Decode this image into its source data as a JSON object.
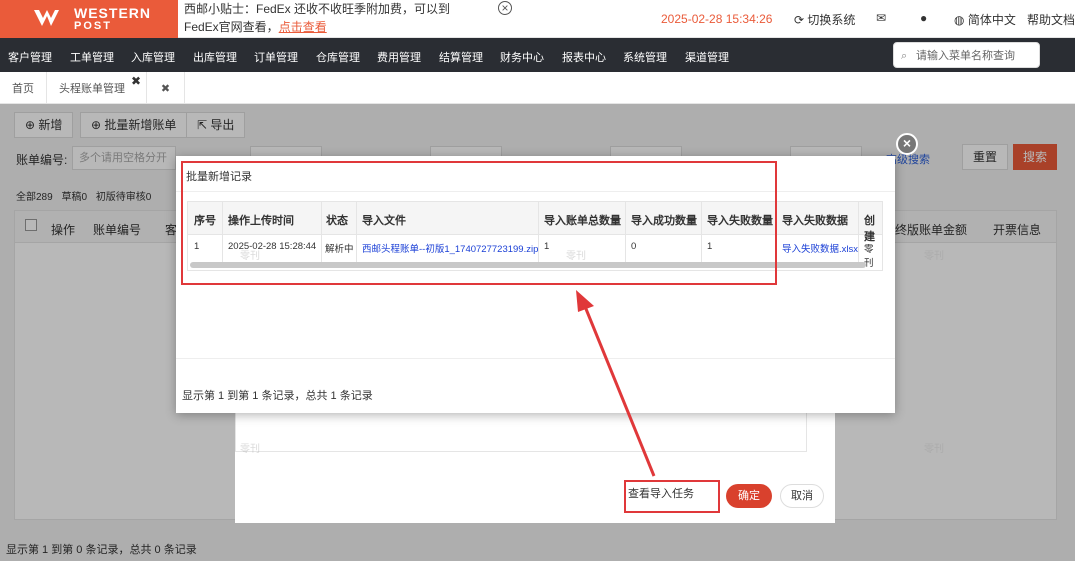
{
  "header": {
    "logo_line1": "WESTERN",
    "logo_line2": "POST",
    "notice_text": "西邮小贴士：FedEx 还收不收旺季附加费，可以到FedEx官网查看，",
    "notice_link": "点击查看",
    "datetime": "2025-02-28 15:34:26",
    "switch_system": "切换系统",
    "language": "简体中文",
    "help": "帮助文档"
  },
  "nav": {
    "items": [
      "客户管理",
      "工单管理",
      "入库管理",
      "出库管理",
      "订单管理",
      "仓库管理",
      "费用管理",
      "结算管理",
      "财务中心",
      "报表中心",
      "系统管理",
      "渠道管理"
    ],
    "search_placeholder": "请输入菜单名称查询"
  },
  "tabs": {
    "home": "首页",
    "current": "头程账单管理"
  },
  "page": {
    "btn_add": "新增",
    "btn_batch_add": "批量新增账单",
    "btn_export": "导出",
    "label_bill_no": "账单编号:",
    "input_bill_no_placeholder": "多个请用空格分开",
    "advanced_search": "高级搜索",
    "btn_reset": "重置",
    "btn_search": "搜索",
    "status_all": "全部289",
    "status_draft": "草稿0",
    "status_first_review": "初版待审核0",
    "col_ops": "操作",
    "col_bill_no": "账单编号",
    "col_cus": "客",
    "col_final_amount": "终版账单金额",
    "col_invoice": "开票信息",
    "footer": "显示第 1 到第 0 条记录，总共 0 条记录"
  },
  "parent_dialog": {
    "view_task": "查看导入任务",
    "confirm": "确定",
    "cancel": "取消"
  },
  "modal": {
    "title": "批量新增记录",
    "close": "×",
    "columns": [
      "序号",
      "操作上传时间",
      "状态",
      "导入文件",
      "导入账单总数量",
      "导入成功数量",
      "导入失败数量",
      "导入失败数据",
      "创建"
    ],
    "rows": [
      {
        "index": "1",
        "time": "2025-02-28 15:28:44",
        "status": "解析中",
        "file": "西邮头程账单--初版1_1740727723199.zip",
        "total": "1",
        "success": "0",
        "failed": "1",
        "failed_data": "导入失败数据.xlsx",
        "creator": "零刊"
      }
    ],
    "footer": "显示第 1 到第 1 条记录，总共 1 条记录"
  },
  "watermark_text": "零刊",
  "colors": {
    "brand": "#ea5b3a",
    "nav_bg": "#2a2d33",
    "annotation_red": "#e0383a",
    "link_blue": "#1a3fd6"
  }
}
